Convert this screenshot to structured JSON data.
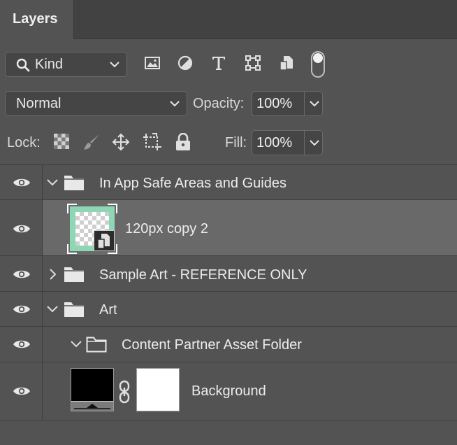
{
  "panel": {
    "tab_label": "Layers"
  },
  "filter": {
    "kind_label": "Kind",
    "icons": [
      "image-filter-icon",
      "adjustment-filter-icon",
      "type-filter-icon",
      "shape-filter-icon",
      "smart-object-filter-icon",
      "filter-toggle-switch"
    ]
  },
  "blend": {
    "mode": "Normal",
    "opacity_label": "Opacity:",
    "opacity_value": "100%"
  },
  "lock": {
    "label": "Lock:",
    "icons": [
      "lock-transparent-pixels-icon",
      "lock-image-pixels-icon",
      "lock-position-icon",
      "lock-artboard-icon",
      "lock-all-icon"
    ],
    "fill_label": "Fill:",
    "fill_value": "100%"
  },
  "layers": [
    {
      "name": "In App Safe Areas and Guides",
      "type": "group",
      "expanded": true,
      "visible": true
    },
    {
      "name": "120px copy 2",
      "type": "smart-object",
      "selected": true,
      "visible": true
    },
    {
      "name": "Sample Art - REFERENCE ONLY",
      "type": "group",
      "expanded": false,
      "visible": true
    },
    {
      "name": "Art",
      "type": "group",
      "expanded": true,
      "visible": true
    },
    {
      "name": "Content Partner Asset Folder",
      "type": "group",
      "expanded": true,
      "visible": true
    },
    {
      "name": "Background",
      "type": "masked-layer",
      "visible": true
    }
  ],
  "colors": {
    "panel_bg": "#535353",
    "selected_row": "#696969",
    "thumbnail_border": "#8fd6b4"
  }
}
